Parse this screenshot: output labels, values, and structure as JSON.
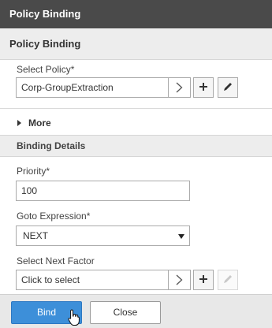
{
  "window": {
    "title": "Policy Binding"
  },
  "panel": {
    "header": "Policy Binding"
  },
  "select_policy": {
    "label": "Select Policy*",
    "value": "Corp-GroupExtraction"
  },
  "more": {
    "label": "More"
  },
  "binding_details": {
    "header": "Binding Details"
  },
  "priority": {
    "label": "Priority*",
    "value": "100"
  },
  "goto_expression": {
    "label": "Goto Expression*",
    "value": "NEXT"
  },
  "next_factor": {
    "label": "Select Next Factor",
    "placeholder": "Click to select"
  },
  "footer": {
    "bind_label": "Bind",
    "close_label": "Close"
  }
}
